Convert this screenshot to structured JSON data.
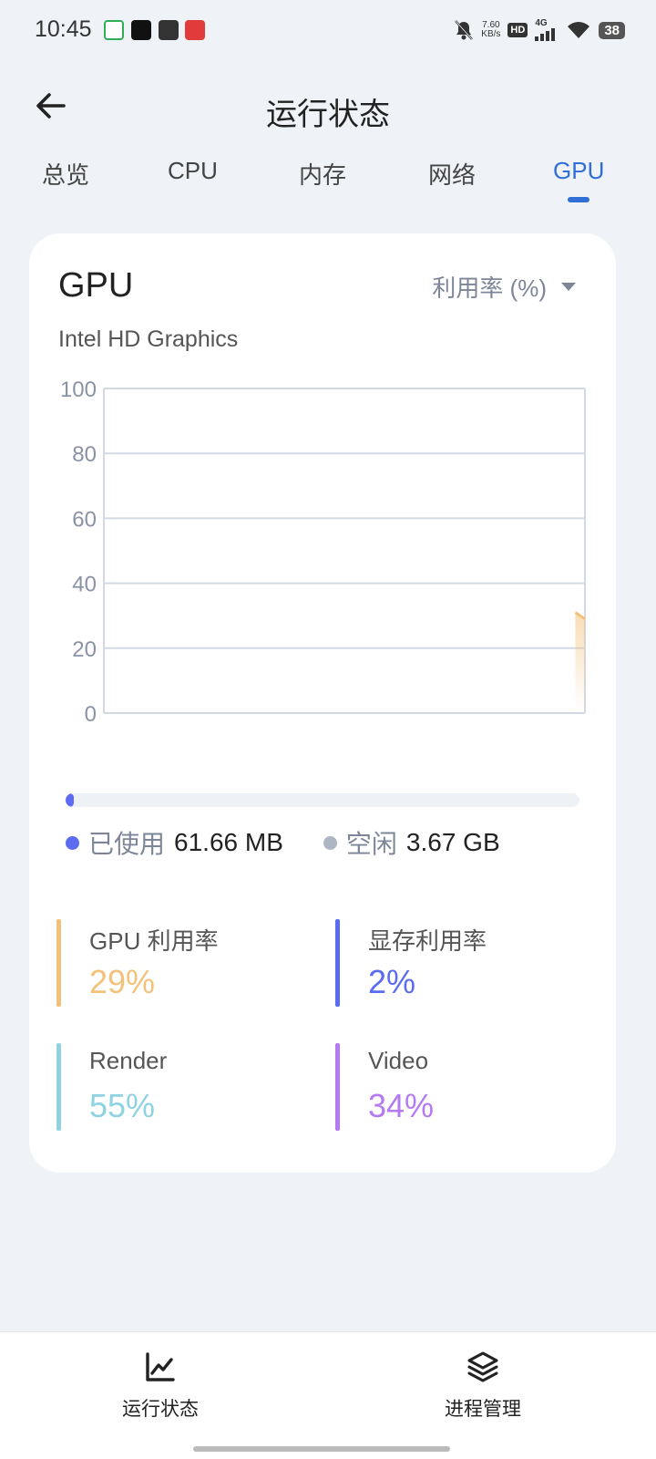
{
  "status_bar": {
    "time": "10:45",
    "net_speed": "7.60",
    "net_speed_unit": "KB/s",
    "hd_badge": "HD",
    "network_type": "4G",
    "battery": "38"
  },
  "header": {
    "title": "运行状态"
  },
  "tabs": [
    {
      "label": "总览",
      "active": false
    },
    {
      "label": "CPU",
      "active": false
    },
    {
      "label": "内存",
      "active": false
    },
    {
      "label": "网络",
      "active": false
    },
    {
      "label": "GPU",
      "active": true
    }
  ],
  "card": {
    "title": "GPU",
    "metric_select": "利用率 (%)",
    "device_name": "Intel HD Graphics"
  },
  "chart_data": {
    "type": "area",
    "title": "",
    "xlabel": "",
    "ylabel": "",
    "ylim": [
      0,
      100
    ],
    "yticks": [
      "100",
      "80",
      "60",
      "40",
      "20",
      "0"
    ],
    "grid": true,
    "x": [
      0.0,
      0.02
    ],
    "series": [
      {
        "values": [
          31,
          29
        ],
        "color": "#f2c27a"
      }
    ],
    "x_domain": [
      0,
      1
    ]
  },
  "memory": {
    "used_fraction": 0.016,
    "used_label": "已使用",
    "used_value": "61.66 MB",
    "used_color": "#5b6cf0",
    "free_label": "空闲",
    "free_value": "3.67 GB",
    "free_color": "#aeb6c4"
  },
  "stats": [
    {
      "label": "GPU 利用率",
      "value": "29%",
      "color": "#f2c27a"
    },
    {
      "label": "显存利用率",
      "value": "2%",
      "color": "#5b6cf0"
    },
    {
      "label": "Render",
      "value": "55%",
      "color": "#8fd3e3"
    },
    {
      "label": "Video",
      "value": "34%",
      "color": "#b57af0"
    }
  ],
  "bottom_nav": [
    {
      "label": "运行状态",
      "icon": "trend-chart-icon"
    },
    {
      "label": "进程管理",
      "icon": "layers-icon"
    }
  ]
}
